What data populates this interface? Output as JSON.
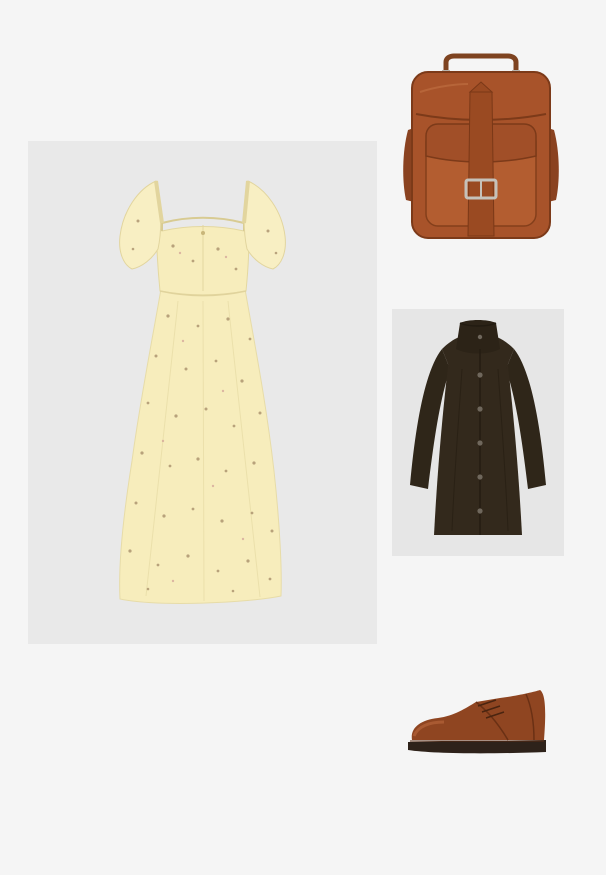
{
  "outfit": {
    "items": [
      {
        "id": "dress",
        "icon": "floral-puff-sleeve-midi-dress",
        "colors": {
          "fabric": "#f7edbc",
          "print": "#8a7a5a",
          "accent": "#c99a8a"
        }
      },
      {
        "id": "bag",
        "icon": "leather-satchel-backpack",
        "colors": {
          "leather": "#a8532a",
          "dark": "#7c3a19",
          "buckle": "#b9b5ae"
        }
      },
      {
        "id": "coat",
        "icon": "funnel-neck-wool-coat",
        "colors": {
          "wool": "#33291c",
          "button": "#6f675c"
        }
      },
      {
        "id": "shoe",
        "icon": "brown-leather-derby-shoe",
        "colors": {
          "leather": "#8f4521",
          "sole": "#2e221a"
        }
      }
    ]
  }
}
